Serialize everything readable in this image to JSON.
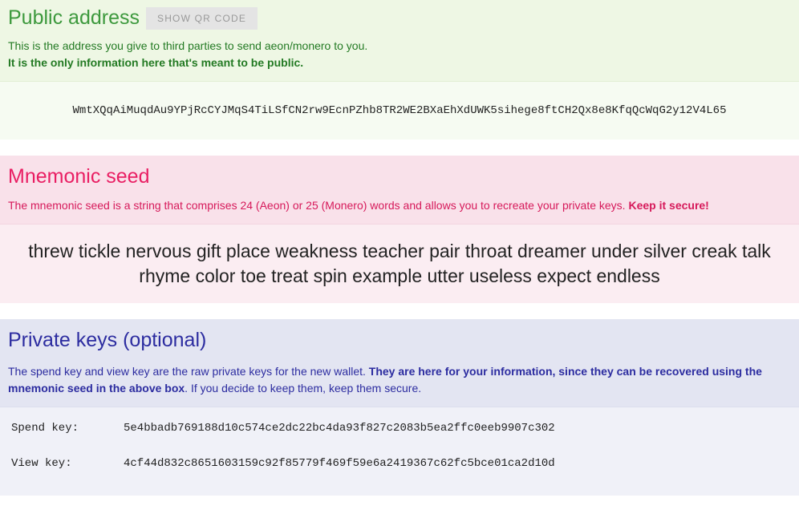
{
  "public_address": {
    "title": "Public address",
    "qr_button": "SHOW QR CODE",
    "desc_line1": "This is the address you give to third parties to send aeon/monero to you.",
    "desc_line2": "It is the only information here that's meant to be public.",
    "value": "WmtXQqAiMuqdAu9YPjRcCYJMqS4TiLSfCN2rw9EcnPZhb8TR2WE2BXaEhXdUWK5sihege8ftCH2Qx8e8KfqQcWqG2y12V4L65"
  },
  "mnemonic": {
    "title": "Mnemonic seed",
    "desc_main": "The mnemonic seed is a string that comprises 24 (Aeon) or 25 (Monero) words and allows you to recreate your private keys. ",
    "desc_strong": "Keep it secure!",
    "value": "threw tickle nervous gift place weakness teacher pair throat dreamer under silver creak talk rhyme color toe treat spin example utter useless expect endless"
  },
  "private_keys": {
    "title": "Private keys (optional)",
    "desc_pre": "The spend key and view key are the raw private keys for the new wallet. ",
    "desc_strong": "They are here for your information, since they can be recovered using the mnemonic seed in the above box",
    "desc_post": ". If you decide to keep them, keep them secure.",
    "spend_label": "Spend key:",
    "spend_value": "5e4bbadb769188d10c574ce2dc22bc4da93f827c2083b5ea2ffc0eeb9907c302",
    "view_label": "View key:",
    "view_value": "4cf44d832c8651603159c92f85779f469f59e6a2419367c62fc5bce01ca2d10d"
  }
}
